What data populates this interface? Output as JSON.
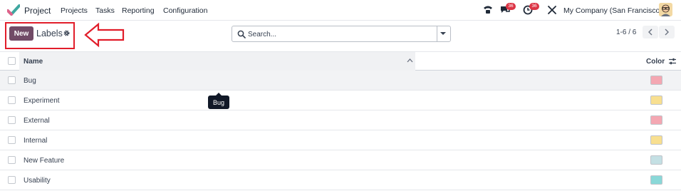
{
  "navbar": {
    "app_name": "Project",
    "menu": [
      "Projects",
      "Tasks",
      "Reporting",
      "Configuration"
    ],
    "messages_badge": "36",
    "activities_badge": "36",
    "company": "My Company (San Francisco)"
  },
  "control_panel": {
    "new_label": "New",
    "breadcrumb": "Labels",
    "search_placeholder": "Search...",
    "pager_value": "1-6 / 6"
  },
  "list": {
    "columns": {
      "name": "Name",
      "color": "Color"
    },
    "rows": [
      {
        "name": "Bug",
        "color": "#f4a7b2"
      },
      {
        "name": "Experiment",
        "color": "#f8df90"
      },
      {
        "name": "External",
        "color": "#f4a7b2"
      },
      {
        "name": "Internal",
        "color": "#f8df90"
      },
      {
        "name": "New Feature",
        "color": "#c4e0e4"
      },
      {
        "name": "Usability",
        "color": "#8ad8d8"
      }
    ]
  },
  "tooltip": {
    "text": "Bug"
  },
  "colors": {
    "brand": "#714b67",
    "annotation": "#e11d2a",
    "badge": "#dc3545"
  }
}
